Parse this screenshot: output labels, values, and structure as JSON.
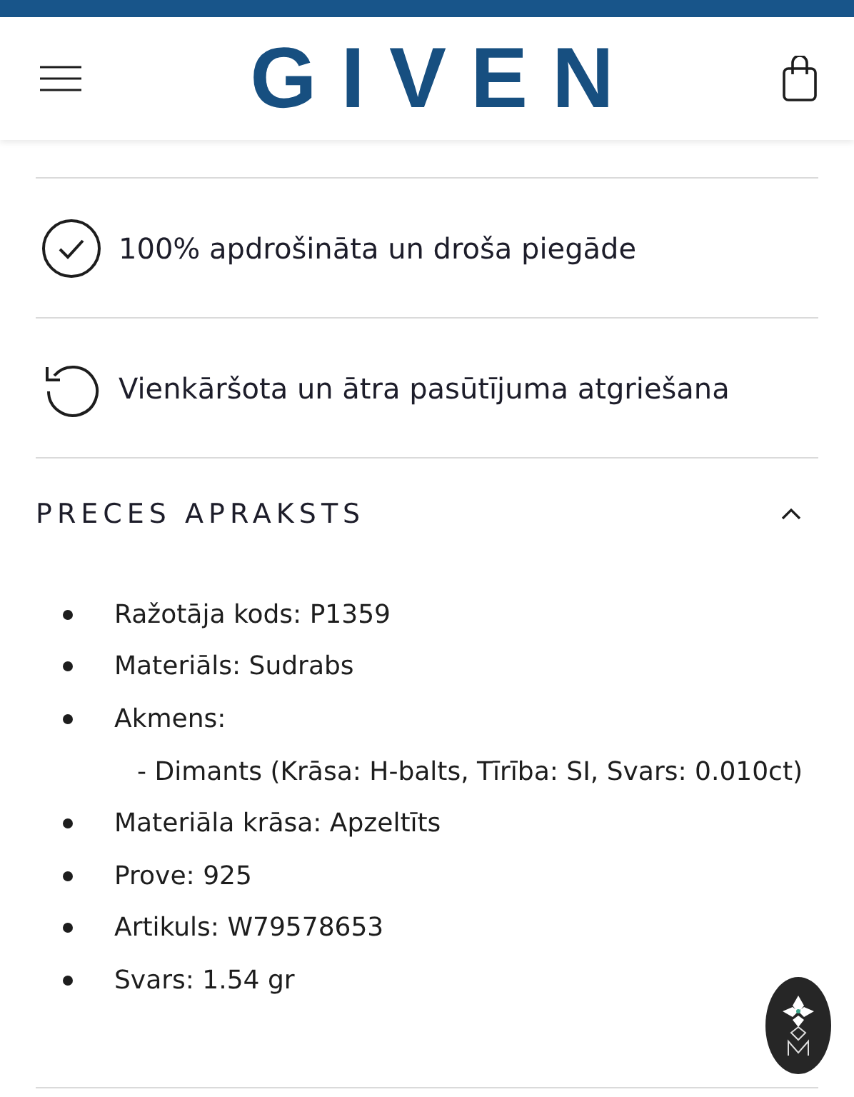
{
  "header": {
    "logo": "GIVEN"
  },
  "features": [
    {
      "kind": "check",
      "text": "100% apdrošināta un droša piegāde"
    },
    {
      "kind": "return",
      "text": "Vienkāršota un ātra pasūtījuma atgriešana"
    }
  ],
  "section": {
    "title": "PRECES APRAKSTS",
    "expanded": true,
    "items": [
      {
        "kind": "bullet",
        "text": "Ražotāja kods: P1359"
      },
      {
        "kind": "bullet",
        "text": "Materiāls: Sudrabs"
      },
      {
        "kind": "bullet",
        "text": "Akmens:"
      },
      {
        "kind": "sub",
        "text": "- Dimants (Krāsa: H-balts, Tīrība: SI, Svars: 0.010ct)"
      },
      {
        "kind": "bullet",
        "text": "Materiāla krāsa: Apzeltīts"
      },
      {
        "kind": "bullet",
        "text": "Prove: 925"
      },
      {
        "kind": "bullet",
        "text": "Artikuls: W79578653"
      },
      {
        "kind": "bullet",
        "text": "Svars: 1.54 gr"
      }
    ]
  }
}
